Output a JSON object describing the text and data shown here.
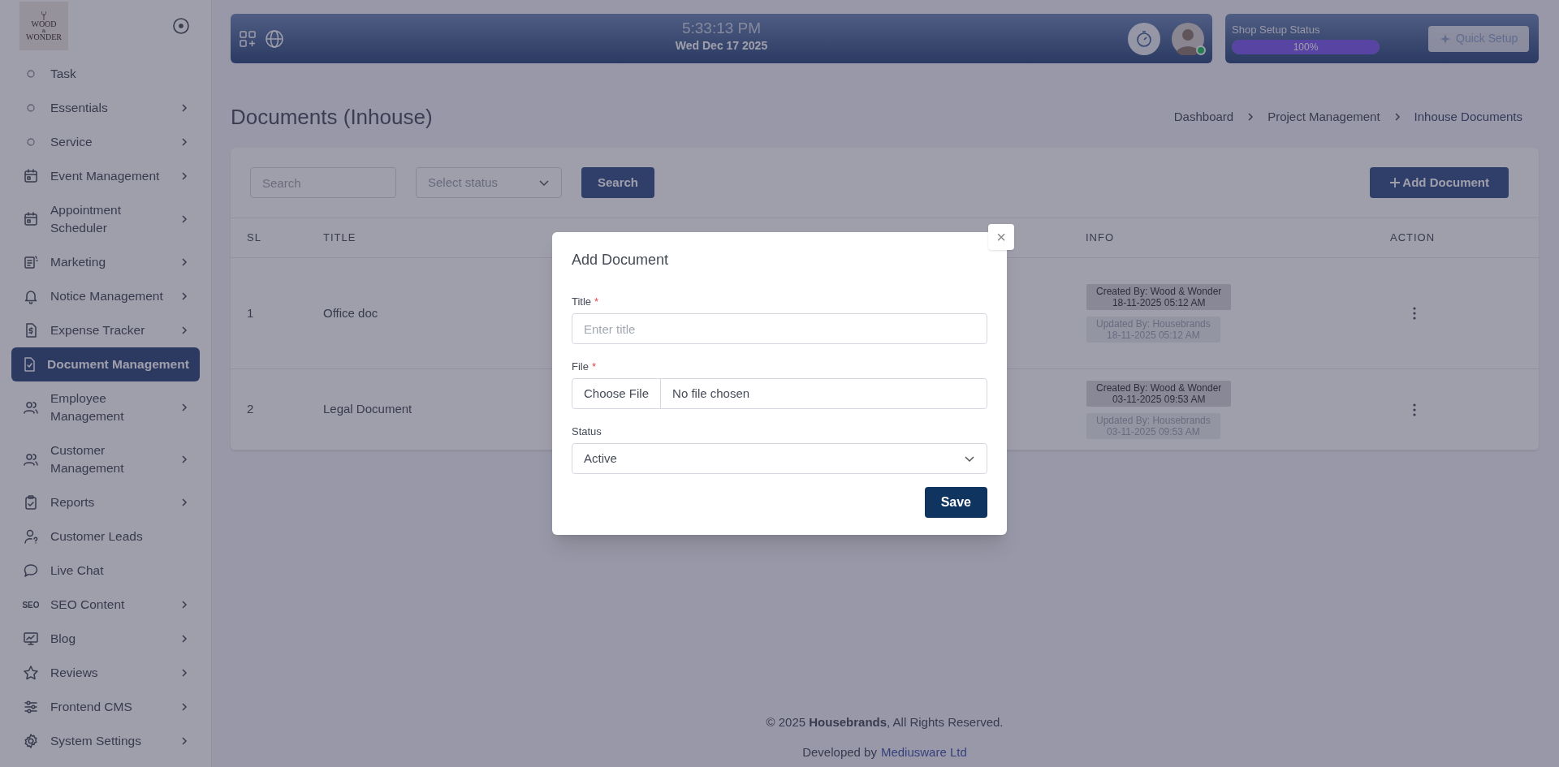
{
  "sidebar": {
    "logo": {
      "line1": "WOOD",
      "line2": "&",
      "line3": "WONDER"
    },
    "items": [
      {
        "label": "Task",
        "kind": "dot",
        "submenu": false,
        "selected": false
      },
      {
        "label": "Essentials",
        "kind": "dot",
        "submenu": true,
        "selected": false
      },
      {
        "label": "Service",
        "kind": "dot",
        "submenu": true,
        "selected": false
      },
      {
        "label": "Event Management",
        "kind": "icon",
        "submenu": true,
        "selected": false
      },
      {
        "label": "Appointment Scheduler",
        "kind": "icon",
        "submenu": true,
        "selected": false
      },
      {
        "label": "Marketing",
        "kind": "icon",
        "submenu": true,
        "selected": false
      },
      {
        "label": "Notice Management",
        "kind": "icon",
        "submenu": true,
        "selected": false
      },
      {
        "label": "Expense Tracker",
        "kind": "icon",
        "submenu": true,
        "selected": false
      },
      {
        "label": "Document Management",
        "kind": "icon",
        "submenu": false,
        "selected": true
      },
      {
        "label": "Employee Management",
        "kind": "icon",
        "submenu": true,
        "selected": false
      },
      {
        "label": "Customer Management",
        "kind": "icon",
        "submenu": true,
        "selected": false
      },
      {
        "label": "Reports",
        "kind": "icon",
        "submenu": true,
        "selected": false
      },
      {
        "label": "Customer Leads",
        "kind": "icon",
        "submenu": false,
        "selected": false
      },
      {
        "label": "Live Chat",
        "kind": "icon",
        "submenu": false,
        "selected": false
      },
      {
        "label": "SEO Content",
        "kind": "seo",
        "icon_text": "SEO",
        "submenu": true,
        "selected": false
      },
      {
        "label": "Blog",
        "kind": "icon",
        "submenu": true,
        "selected": false
      },
      {
        "label": "Reviews",
        "kind": "icon",
        "submenu": true,
        "selected": false
      },
      {
        "label": "Frontend CMS",
        "kind": "icon",
        "submenu": true,
        "selected": false
      },
      {
        "label": "System Settings",
        "kind": "icon",
        "submenu": true,
        "selected": false
      }
    ]
  },
  "header": {
    "time": "5:33:13 PM",
    "date": "Wed Dec 17 2025",
    "online": true,
    "shop_setup": {
      "label": "Shop Setup Status",
      "level": 1,
      "reading": "100%",
      "button": "Quick Setup"
    }
  },
  "page": {
    "title": "Documents (Inhouse)",
    "breadcrumb": [
      "Dashboard",
      "Project Management",
      "Inhouse Documents"
    ]
  },
  "filters": {
    "search_placeholder": "Search",
    "status_placeholder": "Select status",
    "search_button": "Search",
    "add_button": "Add Document"
  },
  "table": {
    "columns": [
      "SL",
      "TITLE",
      "INFO",
      "ACTION"
    ],
    "rows": [
      {
        "sl": "1",
        "title": "Office doc",
        "created": "Created By: Wood & Wonder",
        "created_at": "18-11-2025 05:12 AM",
        "updated": "Updated By: Housebrands",
        "updated_at": "18-11-2025 05:12 AM"
      },
      {
        "sl": "2",
        "title": "Legal Document",
        "created": "Created By: Wood & Wonder",
        "created_at": "03-11-2025 09:53 AM",
        "updated": "Updated By: Housebrands",
        "updated_at": "03-11-2025 09:53 AM"
      }
    ]
  },
  "modal": {
    "title": "Add Document",
    "close": "×",
    "fields": [
      {
        "kind": "text",
        "label": "Title",
        "required_mark": "*",
        "placeholder": "Enter title"
      },
      {
        "kind": "file",
        "label": "File",
        "required_mark": "*",
        "button": "Choose File",
        "value": "No file chosen"
      },
      {
        "kind": "select",
        "label": "Status",
        "value": "Active"
      }
    ],
    "save": "Save"
  },
  "footer": {
    "copyright": "© 2025 **Housebrands**, All Rights Reserved.",
    "developed_by": "Developed by",
    "developer": "Mediusware Ltd"
  }
}
